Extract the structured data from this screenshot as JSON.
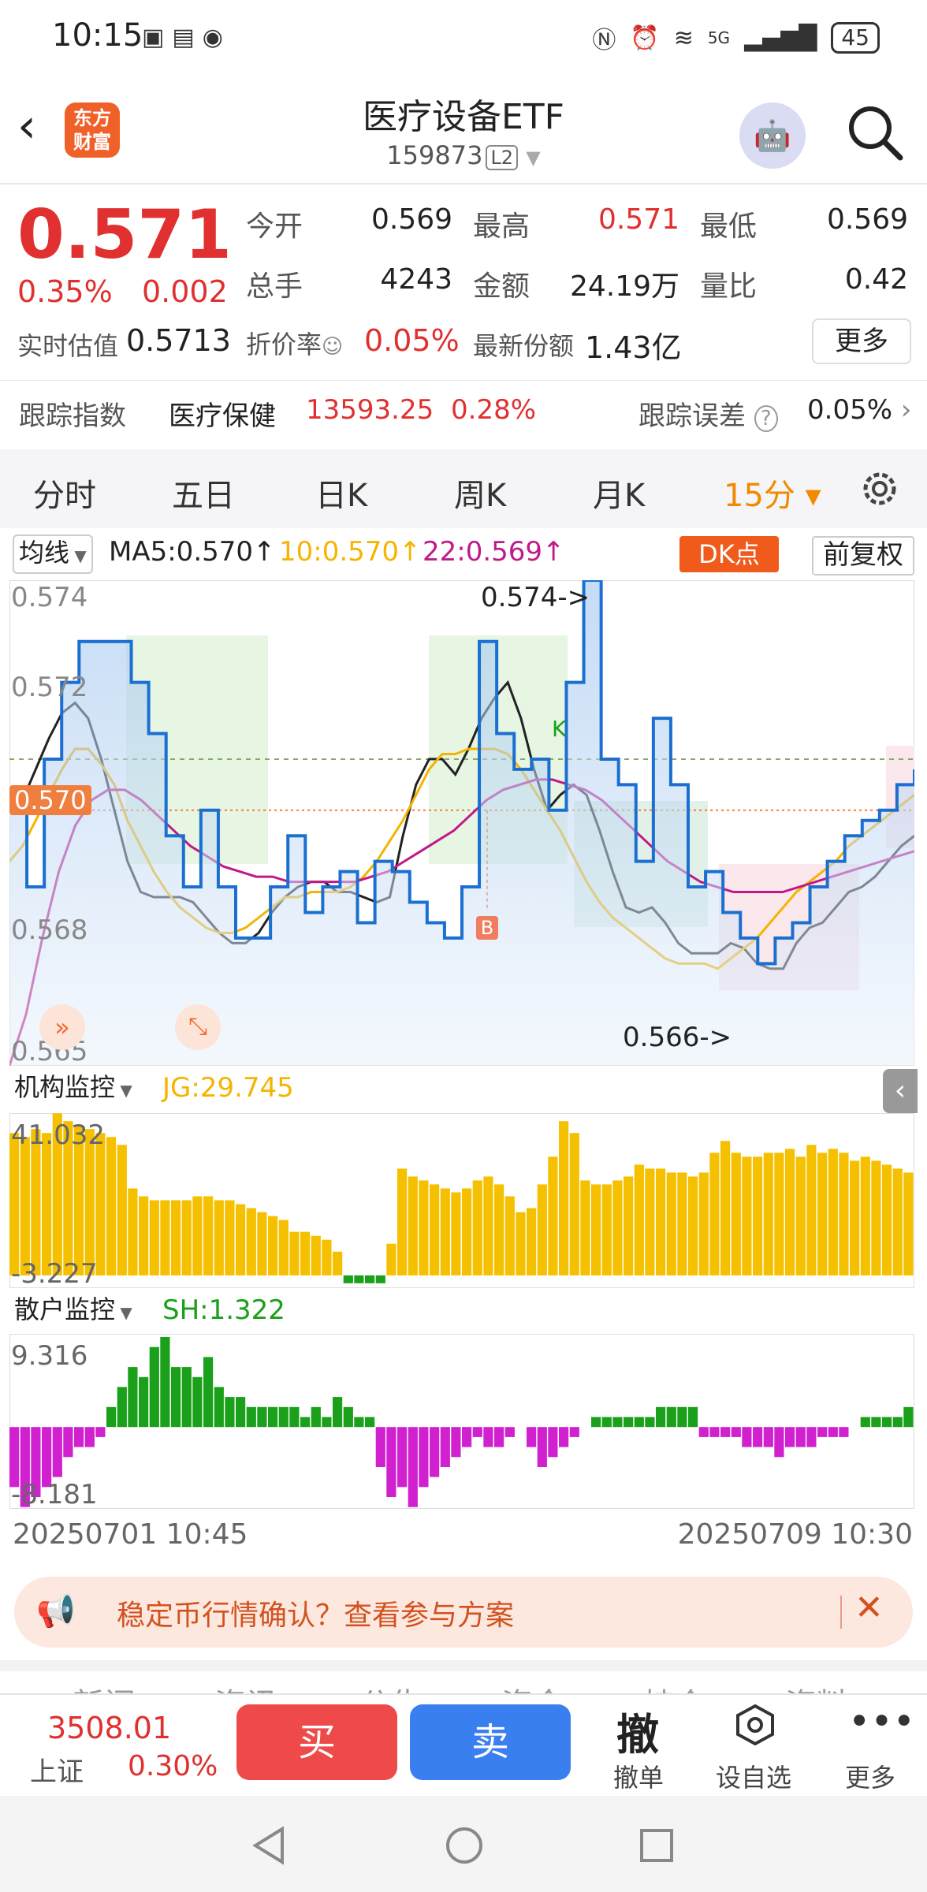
{
  "status_bar": {
    "time": "10:15",
    "battery": "45",
    "network": "5G"
  },
  "header": {
    "logo_line1": "东方",
    "logo_line2": "财富",
    "title": "医疗设备ETF",
    "code": "159873",
    "level": "L2"
  },
  "quote": {
    "price": "0.571",
    "pct": "0.35%",
    "change": "0.002",
    "est_label": "实时估值",
    "est_value": "0.5713",
    "rows": [
      [
        {
          "l": "今开",
          "v": "0.569"
        },
        {
          "l": "最高",
          "v": "0.571",
          "red": true
        },
        {
          "l": "最低",
          "v": "0.569"
        }
      ],
      [
        {
          "l": "总手",
          "v": "4243"
        },
        {
          "l": "金额",
          "v": "24.19万"
        },
        {
          "l": "量比",
          "v": "0.42"
        }
      ]
    ],
    "discount_label": "折价率",
    "discount_value": "0.05%",
    "share_label": "最新份额",
    "share_value": "1.43亿",
    "more": "更多"
  },
  "tracking": {
    "label": "跟踪指数",
    "index_name": "医疗保健",
    "index_value": "13593.25",
    "index_pct": "0.28%",
    "error_label": "跟踪误差",
    "error_value": "0.05%"
  },
  "tabs": [
    "分时",
    "五日",
    "日K",
    "周K",
    "月K",
    "15分"
  ],
  "active_tab": "15分",
  "legend": {
    "selector": "均线",
    "ma5": "MA5:0.570↑",
    "ma10": "10:0.570↑",
    "ma22": "22:0.569↑",
    "dk_button": "DK点",
    "adjust_button": "前复权"
  },
  "colors": {
    "up": "#e03030",
    "ma5": "#222222",
    "ma10": "#f5b400",
    "ma22": "#c0198a",
    "price_line": "#1a6fd1",
    "inst_bar": "#f5c000",
    "retail_pos": "#1aa01a",
    "retail_neg": "#d020d0"
  },
  "chart_data": [
    {
      "type": "line",
      "title": "",
      "y_ticks": [
        "0.574",
        "0.572",
        "0.570",
        "0.568",
        "0.565"
      ],
      "ylim": [
        0.565,
        0.5745
      ],
      "current_price_tag": "0.570",
      "annotations": {
        "high": "0.574->",
        "low": "0.566->",
        "marker_B": "B",
        "marker_K": "K"
      },
      "series": [
        {
          "name": "MA5",
          "values": [
            0.57,
            0.5702,
            0.5708,
            0.5714,
            0.5719,
            0.5721,
            0.5718,
            0.571,
            0.57,
            0.569,
            0.5684,
            0.5683,
            0.5683,
            0.5683,
            0.5682,
            0.5679,
            0.5676,
            0.5674,
            0.5674,
            0.5676,
            0.568,
            0.5683,
            0.5685,
            0.5686,
            0.5686,
            0.5684,
            0.5684,
            0.5683,
            0.5682,
            0.5683,
            0.5695,
            0.5705,
            0.571,
            0.571,
            0.5707,
            0.5712,
            0.5718,
            0.5722,
            0.5725,
            0.5718,
            0.5708,
            0.57,
            0.5703,
            0.5705,
            0.5703,
            0.5696,
            0.5688,
            0.5681,
            0.568,
            0.5681,
            0.5678,
            0.5674,
            0.5672,
            0.5672,
            0.5672,
            0.5674,
            0.5673,
            0.567,
            0.5669,
            0.5669,
            0.5674,
            0.5677,
            0.5678,
            0.5681,
            0.5684,
            0.5685,
            0.5687,
            0.569,
            0.5693,
            0.5695
          ]
        },
        {
          "name": "MA10",
          "values": [
            0.569,
            0.5693,
            0.5698,
            0.5703,
            0.5708,
            0.5712,
            0.5712,
            0.5709,
            0.5705,
            0.5698,
            0.5693,
            0.5688,
            0.5684,
            0.5681,
            0.5679,
            0.5677,
            0.5676,
            0.5676,
            0.5677,
            0.5679,
            0.5681,
            0.5683,
            0.5683,
            0.5684,
            0.5684,
            0.5684,
            0.5685,
            0.5687,
            0.569,
            0.5694,
            0.5698,
            0.5703,
            0.5708,
            0.5711,
            0.5711,
            0.5712,
            0.5712,
            0.5712,
            0.5711,
            0.5708,
            0.5704,
            0.57,
            0.5696,
            0.5691,
            0.5686,
            0.5682,
            0.5679,
            0.5677,
            0.5675,
            0.5673,
            0.5671,
            0.567,
            0.567,
            0.567,
            0.5669,
            0.5671,
            0.5673,
            0.5675,
            0.5678,
            0.5681,
            0.5684,
            0.5686,
            0.5688,
            0.569,
            0.5693,
            0.5695,
            0.5697,
            0.5699,
            0.5701,
            0.5703
          ]
        },
        {
          "name": "MA22",
          "values": [
            0.565,
            0.566,
            0.5675,
            0.5688,
            0.5697,
            0.5702,
            0.5704,
            0.5704,
            0.5702,
            0.5699,
            0.5696,
            0.5693,
            0.5691,
            0.5689,
            0.5688,
            0.5687,
            0.5687,
            0.5686,
            0.5686,
            0.5686,
            0.5686,
            0.5686,
            0.5687,
            0.5688,
            0.569,
            0.5692,
            0.5694,
            0.5696,
            0.5699,
            0.5702,
            0.5704,
            0.5705,
            0.5706,
            0.5706,
            0.5705,
            0.5704,
            0.5702,
            0.5699,
            0.5696,
            0.5693,
            0.569,
            0.5688,
            0.5686,
            0.5685,
            0.5684,
            0.5684,
            0.5684,
            0.5684,
            0.5685,
            0.5686,
            0.5687,
            0.5688,
            0.5689,
            0.569,
            0.5691,
            0.5692
          ]
        },
        {
          "name": "price",
          "values": [
            0.57,
            0.5685,
            0.571,
            0.5725,
            0.5733,
            0.5733,
            0.5733,
            0.5725,
            0.5715,
            0.5695,
            0.5685,
            0.57,
            0.5685,
            0.5675,
            0.5675,
            0.5685,
            0.5695,
            0.568,
            0.5685,
            0.5688,
            0.5678,
            0.569,
            0.5688,
            0.5682,
            0.5678,
            0.5675,
            0.5685,
            0.5733,
            0.5715,
            0.5708,
            0.571,
            0.57,
            0.5725,
            0.5745,
            0.571,
            0.5705,
            0.569,
            0.5718,
            0.5705,
            0.5685,
            0.5688,
            0.568,
            0.5675,
            0.567,
            0.5675,
            0.5678,
            0.5685,
            0.569,
            0.5695,
            0.5698,
            0.57,
            0.5705,
            0.5708
          ]
        }
      ]
    },
    {
      "type": "bar",
      "title": "机构监控",
      "value_label": "JG:29.745",
      "ylim": [
        -3.227,
        41.032
      ],
      "y_ticks": [
        "41.032",
        "-3.227"
      ],
      "values": [
        36,
        35,
        37,
        36,
        41,
        39,
        38,
        37,
        36,
        35,
        33,
        22,
        20,
        19,
        19,
        19,
        19,
        20,
        20,
        19,
        19,
        18,
        17,
        16,
        15,
        14,
        11,
        11,
        10,
        9,
        6,
        -2,
        -2,
        -2,
        -2,
        8,
        27,
        25,
        24,
        23,
        22,
        21,
        22,
        24,
        25,
        23,
        20,
        16,
        17,
        23,
        30,
        39,
        36,
        24,
        23,
        23,
        24,
        25,
        28,
        27,
        27,
        26,
        26,
        25,
        26,
        31,
        34,
        31,
        30,
        30,
        31,
        31,
        32,
        30,
        33,
        31,
        32,
        31,
        29,
        30,
        29,
        28,
        27,
        26
      ]
    },
    {
      "type": "bar",
      "title": "散户监控",
      "value_label": "SH:1.322",
      "ylim": [
        -8.181,
        9.316
      ],
      "y_ticks": [
        "9.316",
        "-8.181"
      ],
      "values": [
        -6,
        -8,
        -7,
        -6,
        -5,
        -3,
        -2,
        -2,
        -1,
        2,
        4,
        6,
        5,
        8,
        9,
        6,
        6,
        5,
        7,
        4,
        3,
        3,
        2,
        2,
        2,
        2,
        2,
        1,
        2,
        1,
        3,
        2,
        1,
        1,
        -4,
        -7,
        -6,
        -8,
        -6,
        -5,
        -4,
        -3,
        -2,
        -1,
        -2,
        -2,
        -1,
        0,
        -2,
        -4,
        -3,
        -2,
        -1,
        0,
        1,
        1,
        1,
        1,
        1,
        1,
        2,
        2,
        2,
        2,
        -1,
        -1,
        -1,
        -1,
        -2,
        -2,
        -2,
        -3,
        -2,
        -2,
        -2,
        -1,
        -1,
        -1,
        0,
        1,
        1,
        1,
        1,
        2
      ]
    }
  ],
  "time_axis": {
    "start": "20250701 10:45",
    "end": "20250709 10:30"
  },
  "banner": {
    "text": "稳定币行情确认？查看参与方案"
  },
  "bottom_tabs_faded": [
    "新闻",
    "资讯",
    "公告",
    "资金",
    "持仓",
    "资料"
  ],
  "bottom_bar": {
    "index_value": "3508.01",
    "index_name": "上证",
    "index_pct": "0.30%",
    "buy": "买",
    "sell": "卖",
    "cancel_icon_text": "撤",
    "cancel": "撤单",
    "watchlist": "设自选",
    "more": "更多"
  }
}
